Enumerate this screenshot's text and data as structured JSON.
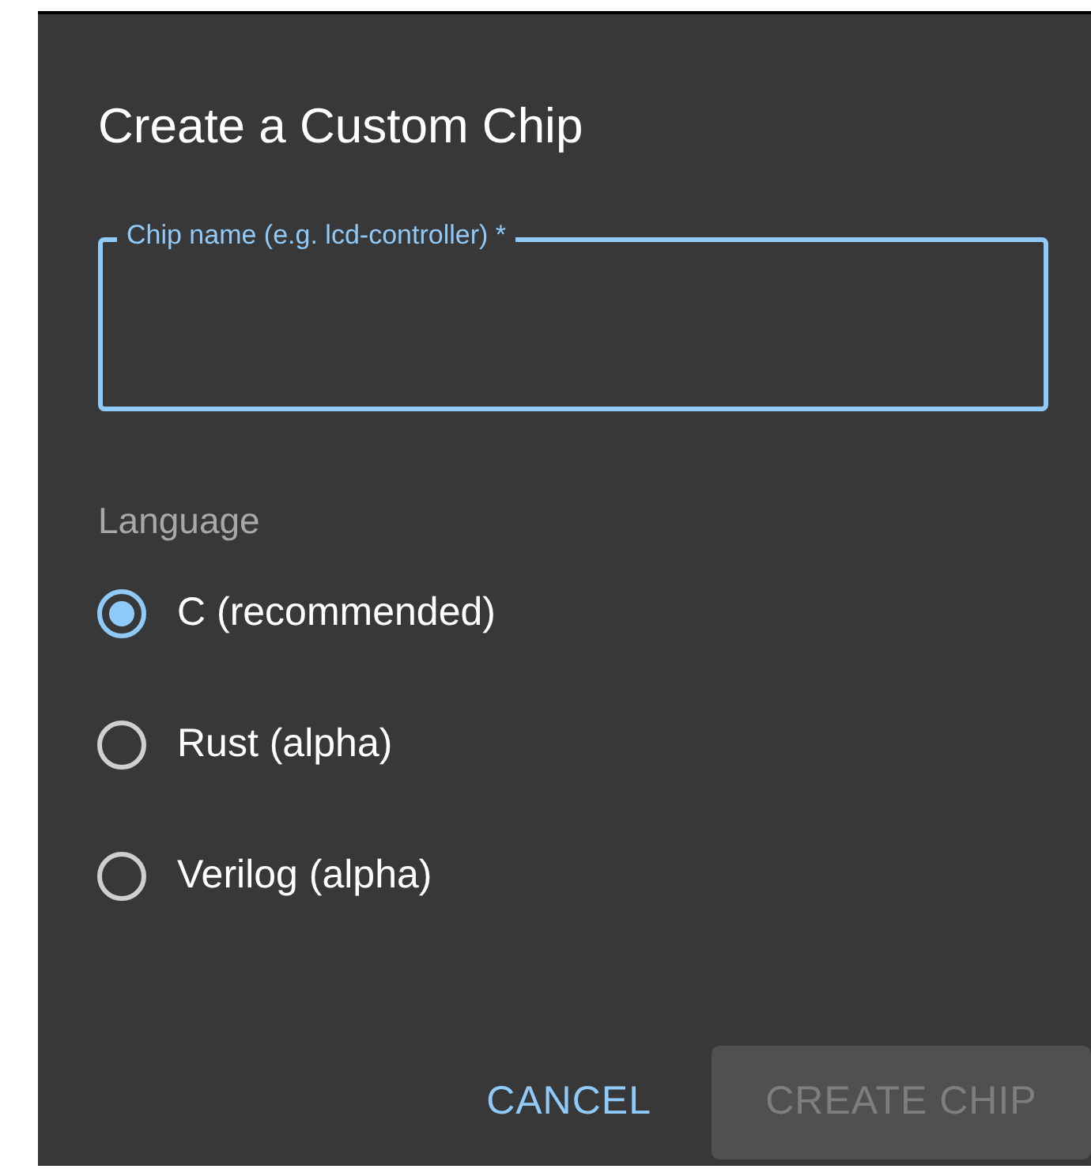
{
  "dialog": {
    "title": "Create a Custom Chip",
    "name_field": {
      "label": "Chip name (e.g. lcd-controller) *",
      "focused": true
    },
    "language": {
      "label": "Language",
      "options": [
        {
          "label": "C (recommended)",
          "selected": true
        },
        {
          "label": "Rust (alpha)",
          "selected": false
        },
        {
          "label": "Verilog (alpha)",
          "selected": false
        }
      ]
    },
    "buttons": [
      {
        "label": "CANCEL",
        "kind": "text",
        "disabled": false
      },
      {
        "label": "CREATE CHIP",
        "kind": "contained",
        "disabled": true
      }
    ]
  }
}
